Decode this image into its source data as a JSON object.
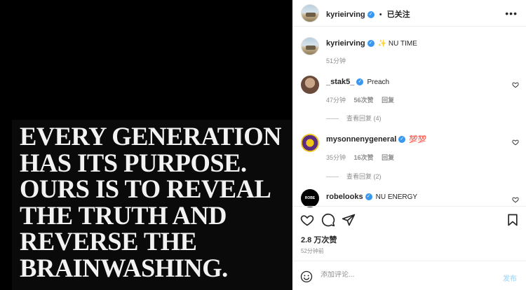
{
  "post": {
    "quote_lines": [
      "EVERY GENERATION",
      "HAS ITS PURPOSE.",
      "OURS IS TO REVEAL",
      "THE TRUTH AND",
      "REVERSE THE",
      "BRAINWASHING."
    ]
  },
  "header": {
    "username": "kyrieirving",
    "separator": "•",
    "follow_status": "已关注",
    "more_icon": "more-horizontal-icon"
  },
  "caption": {
    "username": "kyrieirving",
    "text": "✨ NU TIME",
    "time": "51分钟"
  },
  "comments": [
    {
      "username": "_stak5_",
      "text": "Preach",
      "time": "47分钟",
      "likes": "56次赞",
      "reply": "回复",
      "view_replies": "查看回复 (4)"
    },
    {
      "username": "mysonnenygeneral",
      "text": "💯💯",
      "time": "35分钟",
      "likes": "16次赞",
      "reply": "回复",
      "view_replies": "查看回复 (2)"
    },
    {
      "username": "robelooks",
      "text": "NU ENERGY",
      "avatar_text": "ROBE"
    }
  ],
  "actions": {
    "likes": "2.8 万次赞",
    "post_time": "52分钟前"
  },
  "comment_box": {
    "placeholder": "添加评论...",
    "post_label": "发布"
  }
}
